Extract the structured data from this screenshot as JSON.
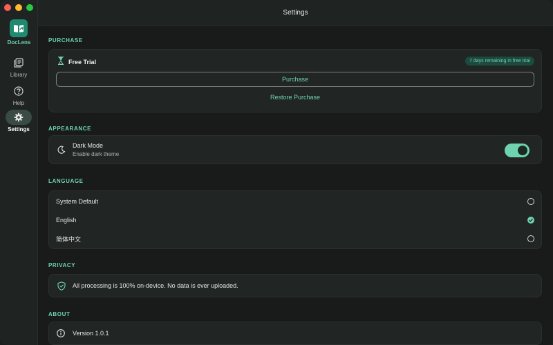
{
  "window": {
    "title": "Settings"
  },
  "app": {
    "name": "DocLens"
  },
  "sidebar": {
    "items": [
      {
        "label": "Library",
        "icon": "library-icon",
        "active": false
      },
      {
        "label": "Help",
        "icon": "help-icon",
        "active": false
      },
      {
        "label": "Settings",
        "icon": "gear-icon",
        "active": true
      }
    ]
  },
  "purchase": {
    "section_title": "PURCHASE",
    "plan_label": "Free Trial",
    "plan_icon": "hourglass-icon",
    "badge": "7 days remaining in free trial",
    "purchase_button": "Purchase",
    "restore_link": "Restore Purchase"
  },
  "appearance": {
    "section_title": "APPEARANCE",
    "dark_mode_label": "Dark Mode",
    "dark_mode_sub": "Enable dark theme",
    "dark_mode_enabled": true
  },
  "language": {
    "section_title": "LANGUAGE",
    "options": [
      {
        "label": "System Default",
        "selected": false
      },
      {
        "label": "English",
        "selected": true
      },
      {
        "label": "简体中文",
        "selected": false
      }
    ]
  },
  "privacy": {
    "section_title": "PRIVACY",
    "text": "All processing is 100% on-device. No data is ever uploaded."
  },
  "about": {
    "section_title": "ABOUT",
    "version": "Version 1.0.1"
  },
  "colors": {
    "accent": "#6fd3b0",
    "background": "#181b1a",
    "card": "#212524"
  }
}
